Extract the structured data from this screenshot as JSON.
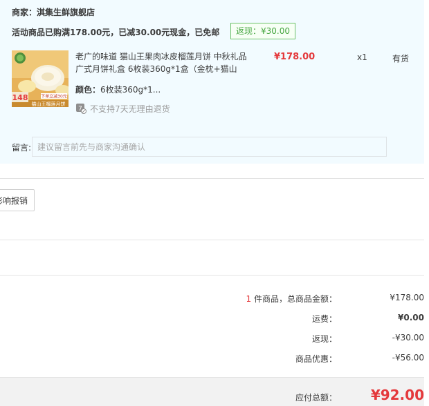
{
  "shop": {
    "label": "商家：",
    "name": "淇集生鲜旗舰店"
  },
  "promo": {
    "text": "活动商品已购满178.00元，已减30.00元现金，已免邮",
    "cashback_badge": "返现：¥30.00"
  },
  "item": {
    "image_label": "product-thumbnail",
    "image_text_price": "148",
    "image_text_banner": "猫山王榴莲月饼",
    "image_text_sub": "下单立减30元",
    "title": "老广的味道 猫山王果肉冰皮榴莲月饼 中秋礼品广式月饼礼盒 6枚装360g*1盒（金枕+猫山",
    "spec_key": "颜色：",
    "spec_value": "6枚装360g*1...",
    "return_policy": "不支持7天无理由退货",
    "return_icon_text": "7",
    "price": "¥178.00",
    "qty": "x1",
    "stock": "有货"
  },
  "memo": {
    "label": "留言:",
    "placeholder": "建议留言前先与商家沟通确认"
  },
  "reimburse": {
    "label": "影响报销"
  },
  "summary": {
    "count_num": "1",
    "count_label": "件商品，总商品金额：",
    "goods_total": "¥178.00",
    "shipping_label": "运费：",
    "shipping_value": "¥0.00",
    "cashback_label": "返现：",
    "cashback_value": "-¥30.00",
    "discount_label": "商品优惠：",
    "discount_value": "-¥56.00",
    "payable_label": "应付总额：",
    "payable_value": "¥92.00"
  },
  "colors": {
    "accent_red": "#e4393c",
    "cashback_green": "#45a640",
    "order_bg": "#f2fbff"
  }
}
